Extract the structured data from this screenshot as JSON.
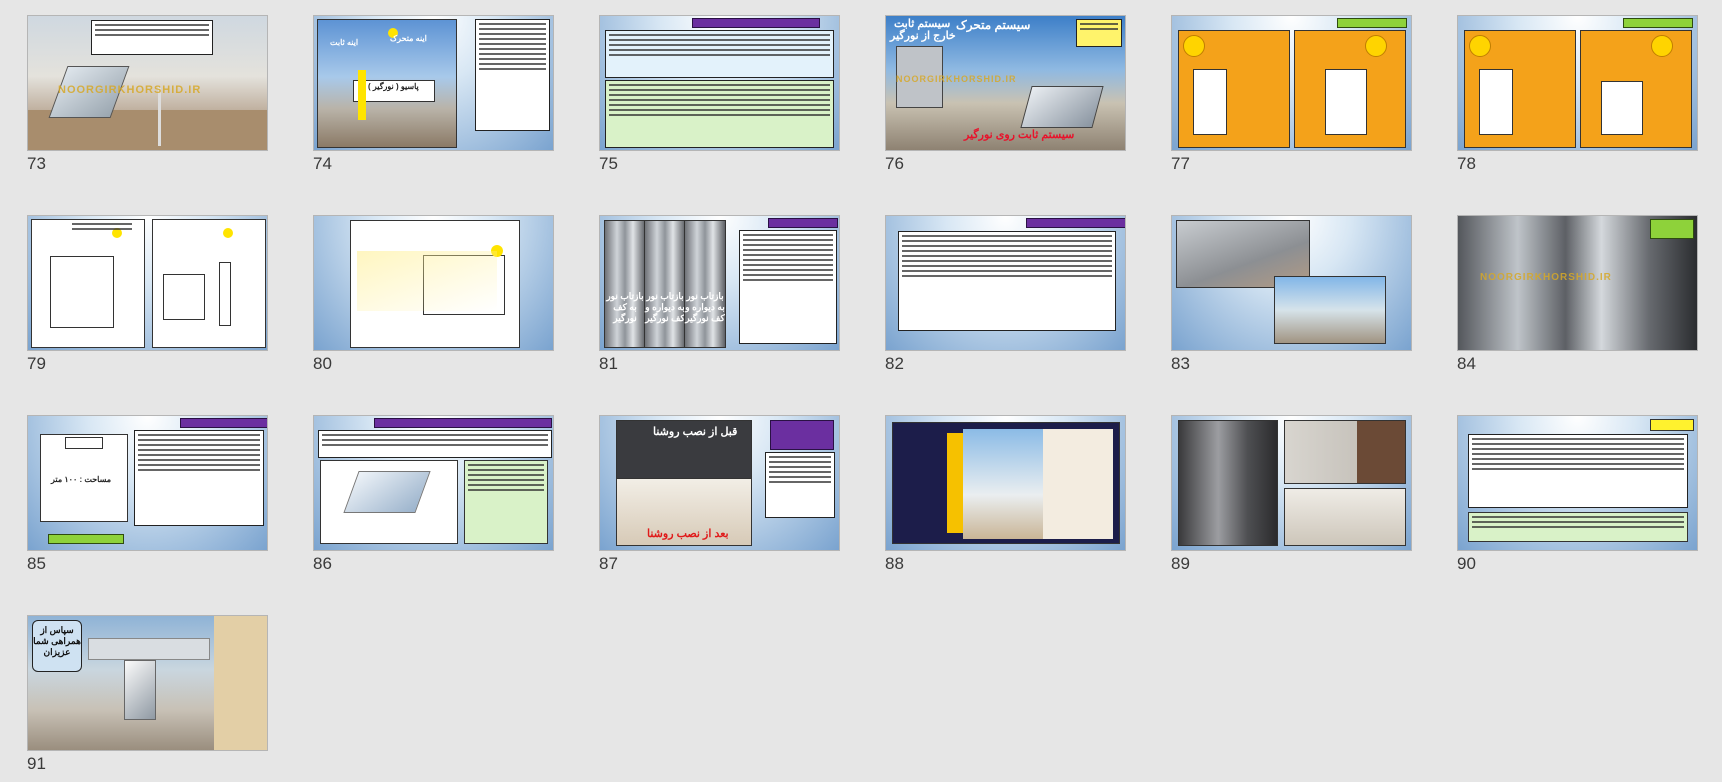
{
  "slides": [
    {
      "number": "73",
      "background": "#c8b59a",
      "watermark": "NOORGIRKHORSHID.IR"
    },
    {
      "number": "74",
      "labels": {
        "moving_mirror": "اینه متحرک",
        "fixed_mirror": "اینه ثابت",
        "passive": "پاسیو ( نورگیر )"
      }
    },
    {
      "number": "75"
    },
    {
      "number": "76",
      "labels": {
        "moving_system": "سیستم متحرک",
        "fixed_system": "سیستم ثابت",
        "outside": "خارج از نورگیر",
        "on_skylight": "سیستم ثابت روی نورگیر"
      },
      "watermark": "NOORGIRKHORSHID.IR"
    },
    {
      "number": "77",
      "background": "#f4a21a"
    },
    {
      "number": "78",
      "background": "#f4a21a"
    },
    {
      "number": "79"
    },
    {
      "number": "80"
    },
    {
      "number": "81",
      "labels": {
        "p1": "بازتاب نور به کف نورگیر",
        "p2": "بازتاب نور به دیواره و کف نورگیر",
        "p3": "بازتاب نور به دیواره و کف نورگیر"
      }
    },
    {
      "number": "82"
    },
    {
      "number": "83"
    },
    {
      "number": "84",
      "watermark": "NOORGIRKHORSHID.IR"
    },
    {
      "number": "85",
      "labels": {
        "area": "مساحت : ۱۰۰ متر"
      }
    },
    {
      "number": "86"
    },
    {
      "number": "87",
      "labels": {
        "before": "قبل از نصب روشنا",
        "after": "بعد از نصب روشنا"
      }
    },
    {
      "number": "88"
    },
    {
      "number": "89"
    },
    {
      "number": "90"
    },
    {
      "number": "91",
      "labels": {
        "thanks": "سپاس از همراهی شما عزیزان"
      }
    }
  ]
}
